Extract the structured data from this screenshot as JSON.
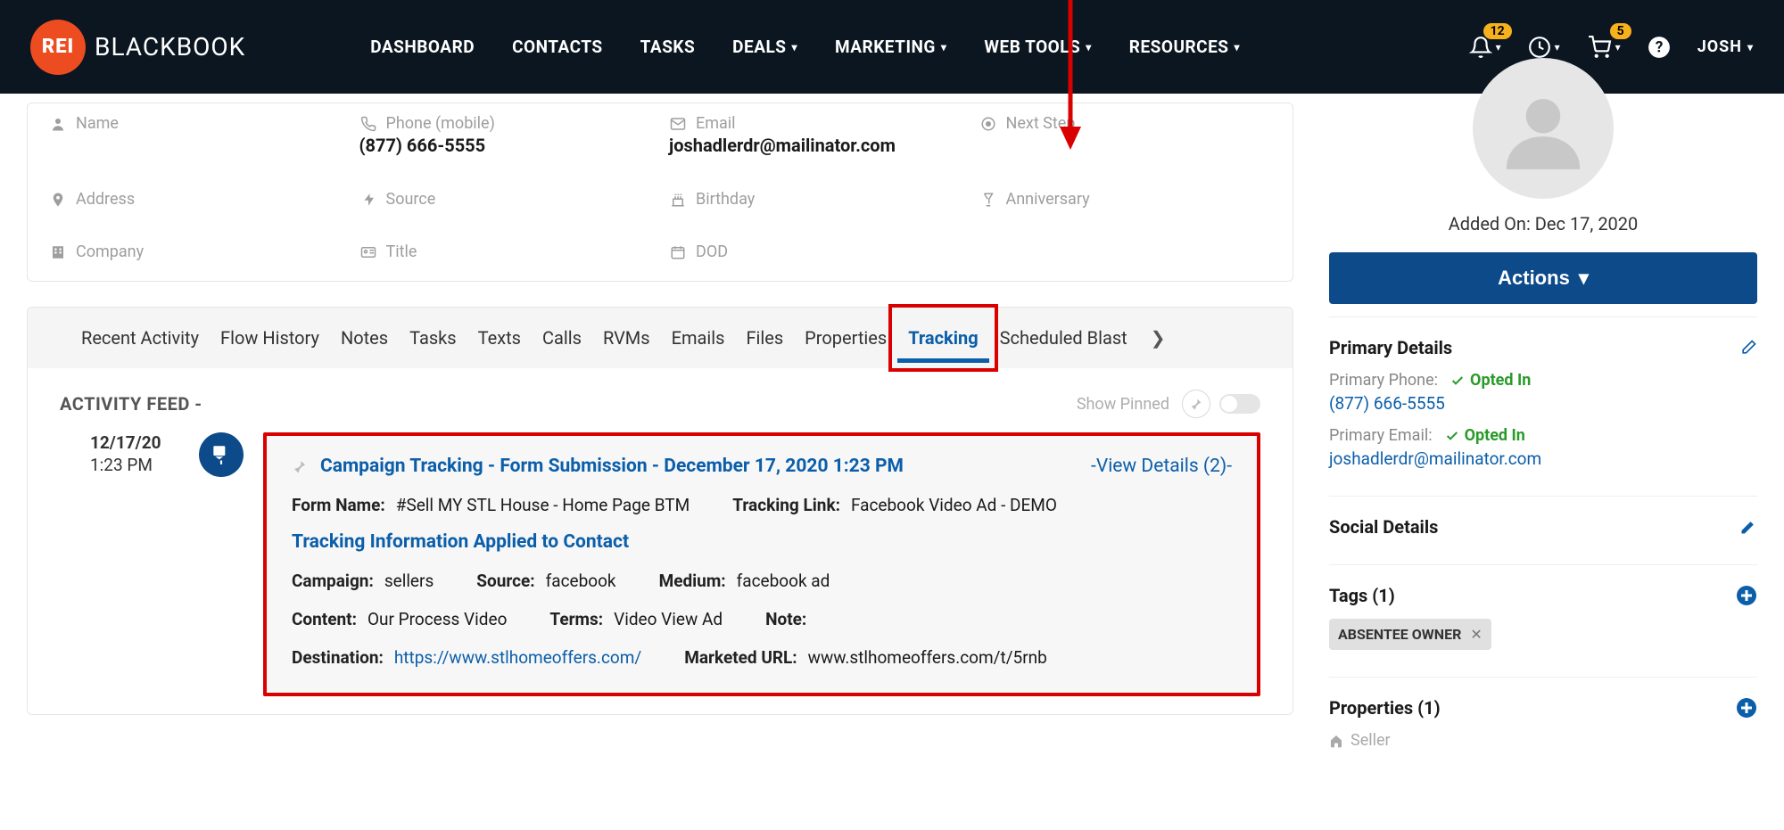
{
  "brand": {
    "badge": "REI",
    "text": "BLACKBOOK"
  },
  "nav": {
    "dashboard": "DASHBOARD",
    "contacts": "CONTACTS",
    "tasks": "TASKS",
    "deals": "DEALS",
    "marketing": "MARKETING",
    "webtools": "WEB TOOLS",
    "resources": "RESOURCES"
  },
  "topright": {
    "bell_badge": "12",
    "cart_badge": "5",
    "user": "JOSH"
  },
  "contact": {
    "name_label": "Name",
    "phone_label": "Phone  (mobile)",
    "phone_value": "(877) 666-5555",
    "email_label": "Email",
    "email_value": "joshadlerdr@mailinator.com",
    "nextstep_label": "Next Step",
    "address_label": "Address",
    "source_label": "Source",
    "birthday_label": "Birthday",
    "anniversary_label": "Anniversary",
    "company_label": "Company",
    "title_label": "Title",
    "dod_label": "DOD"
  },
  "tabs": {
    "recent": "Recent Activity",
    "flow": "Flow History",
    "notes": "Notes",
    "tasks": "Tasks",
    "texts": "Texts",
    "calls": "Calls",
    "rvms": "RVMs",
    "emails": "Emails",
    "files": "Files",
    "properties": "Properties",
    "tracking": "Tracking",
    "blast": "Scheduled Blast"
  },
  "feed": {
    "title": "ACTIVITY FEED -",
    "show_pinned": "Show Pinned",
    "item": {
      "date": "12/17/20",
      "time": "1:23 PM",
      "headline": "Campaign Tracking - Form Submission - December 17, 2020 1:23 PM",
      "view_details": "-View Details (2)-",
      "form_name_lbl": "Form Name:",
      "form_name_val": "#Sell MY STL House - Home Page BTM",
      "tracking_link_lbl": "Tracking Link:",
      "tracking_link_val": "Facebook Video Ad - DEMO",
      "subhead": "Tracking Information Applied to Contact",
      "campaign_lbl": "Campaign:",
      "campaign_val": "sellers",
      "source_lbl": "Source:",
      "source_val": "facebook",
      "medium_lbl": "Medium:",
      "medium_val": "facebook ad",
      "content_lbl": "Content:",
      "content_val": "Our Process Video",
      "terms_lbl": "Terms:",
      "terms_val": "Video View Ad",
      "note_lbl": "Note:",
      "destination_lbl": "Destination:",
      "destination_val": "https://www.stlhomeoffers.com/",
      "marketed_lbl": "Marketed URL:",
      "marketed_val": "www.stlhomeoffers.com/t/5rnb"
    }
  },
  "sidebar": {
    "added_on": "Added On: Dec 17, 2020",
    "actions": "Actions",
    "primary_details": "Primary Details",
    "primary_phone_lbl": "Primary Phone:",
    "opted_in": "Opted In",
    "primary_phone_val": "(877) 666-5555",
    "primary_email_lbl": "Primary Email:",
    "primary_email_val": "joshadlerdr@mailinator.com",
    "social_details": "Social Details",
    "tags_title": "Tags (1)",
    "tag0": "ABSENTEE OWNER",
    "properties_title": "Properties (1)",
    "seller": "Seller"
  }
}
